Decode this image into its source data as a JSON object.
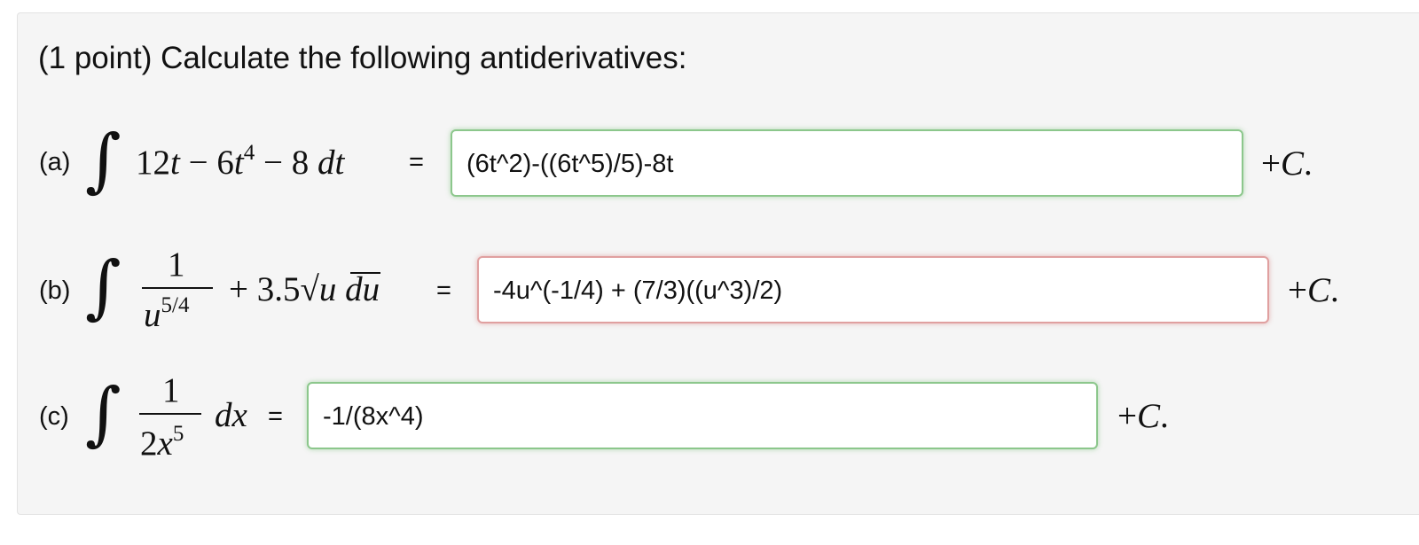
{
  "problem": {
    "title": "(1 point) Calculate the following antiderivatives:"
  },
  "parts": {
    "a": {
      "label": "(a)",
      "integrand_c1": "12",
      "integrand_v1": "t",
      "minus1": "−",
      "integrand_c2": "6",
      "integrand_v2": "t",
      "exp2": "4",
      "minus2": "−",
      "integrand_c3": "8",
      "differential": "dt",
      "equals": "=",
      "answer": "(6t^2)-((6t^5)/5)-8t",
      "status": "correct",
      "constant": "+C."
    },
    "b": {
      "label": "(b)",
      "numerator": "1",
      "denominator_var": "u",
      "denominator_exp": "5/4",
      "plus": "+",
      "coef": "3.5",
      "radical": "√",
      "radicand": "u",
      "differential": "du",
      "equals": "=",
      "answer": "-4u^(-1/4) + (7/3)((u^3)/2)",
      "status": "incorrect",
      "constant": "+C."
    },
    "c": {
      "label": "(c)",
      "numerator": "1",
      "denominator_coef": "2",
      "denominator_var": "x",
      "denominator_exp": "5",
      "differential": "dx",
      "equals": "=",
      "answer": "-1/(8x^4)",
      "status": "correct",
      "constant": "+C."
    }
  },
  "colors": {
    "correct_border": "#8cc78c",
    "incorrect_border": "#e0a0a0",
    "panel_background": "#f5f5f5"
  }
}
